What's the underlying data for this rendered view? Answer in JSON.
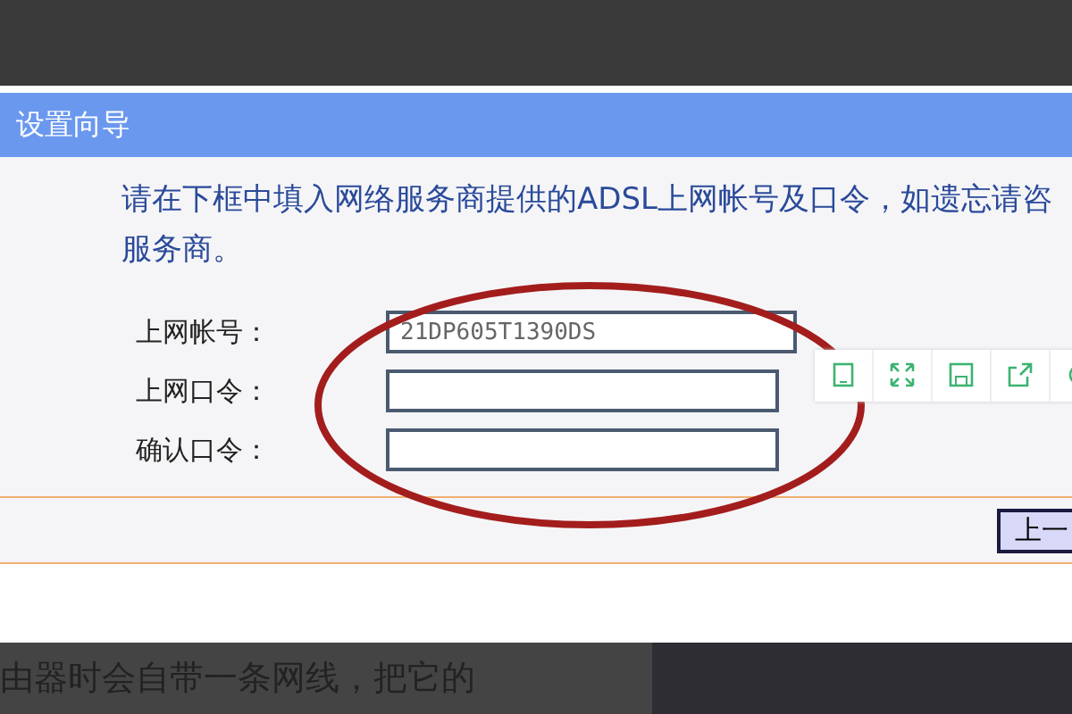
{
  "dialog": {
    "title": "设置向导",
    "instructions": [
      "请在下框中填入网络服务商提供的ADSL上网帐号及口令，如遗忘请咨",
      "服务商。"
    ],
    "fields": [
      {
        "label": "上网帐号：",
        "value": "21DP605T1390DS"
      },
      {
        "label": "上网口令："
      },
      {
        "label": "确认口令："
      }
    ],
    "back_button": "上一"
  },
  "image_toolbar": {
    "tools": [
      {
        "kind": "tablet"
      },
      {
        "kind": "expand"
      },
      {
        "kind": "save"
      },
      {
        "kind": "share"
      },
      {
        "kind": "more"
      }
    ]
  },
  "article_text": "由器时会自带一条网线，把它的"
}
